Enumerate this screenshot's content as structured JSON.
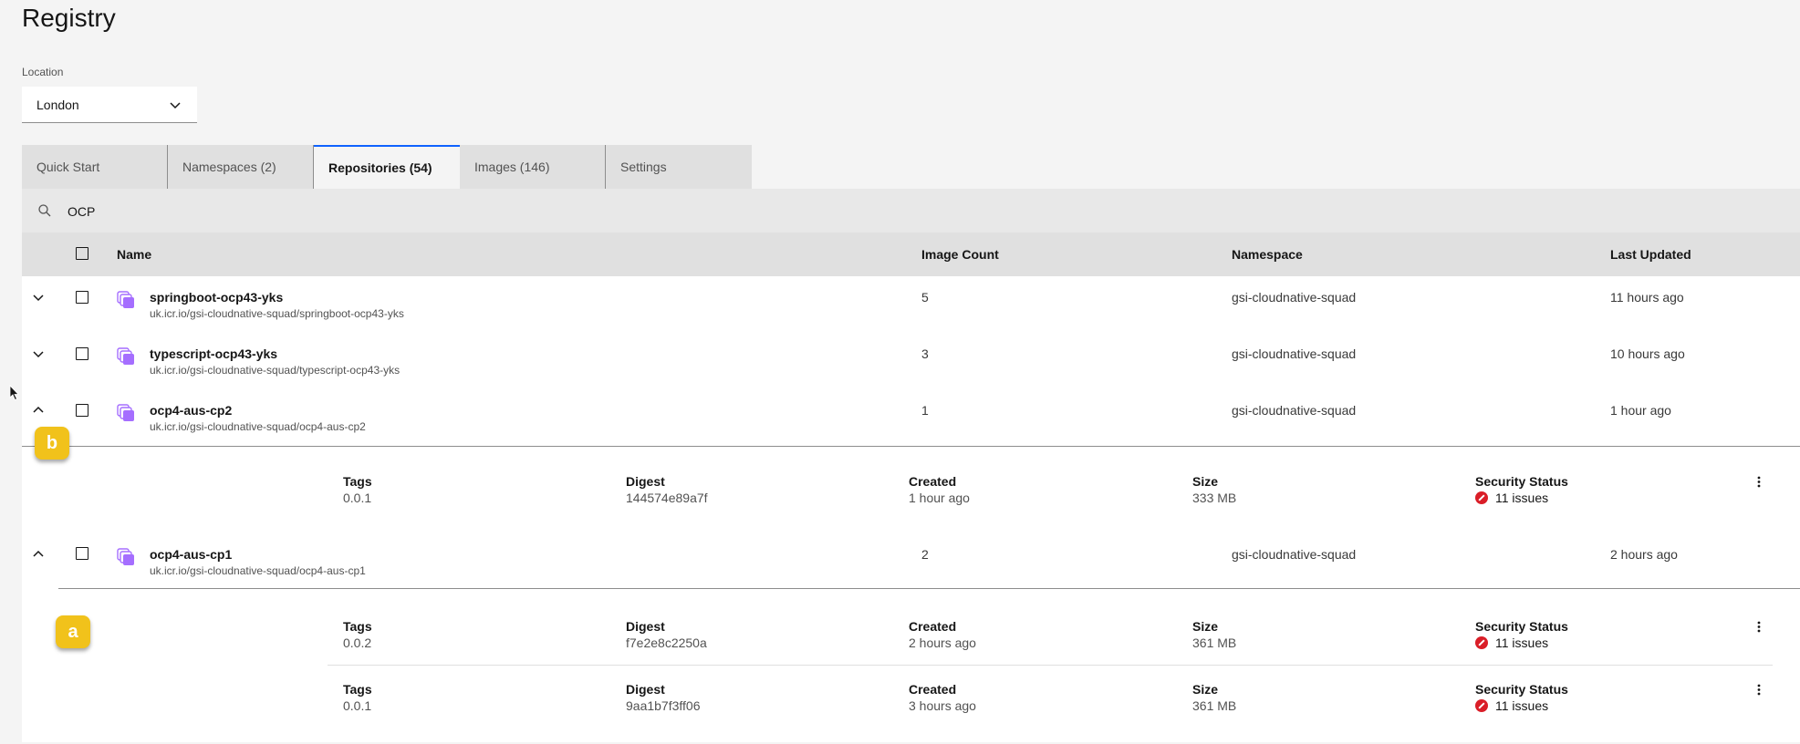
{
  "page": {
    "title": "Registry"
  },
  "location": {
    "label": "Location",
    "value": "London"
  },
  "tabs": [
    {
      "label": "Quick Start",
      "active": false
    },
    {
      "label": "Namespaces (2)",
      "active": false
    },
    {
      "label": "Repositories (54)",
      "active": true
    },
    {
      "label": "Images (146)",
      "active": false
    },
    {
      "label": "Settings",
      "active": false
    }
  ],
  "search": {
    "value": "OCP"
  },
  "table": {
    "headers": {
      "name": "Name",
      "image_count": "Image Count",
      "namespace": "Namespace",
      "last_updated": "Last Updated"
    },
    "rows": [
      {
        "name": "springboot-ocp43-yks",
        "path": "uk.icr.io/gsi-cloudnative-squad/springboot-ocp43-yks",
        "image_count": "5",
        "namespace": "gsi-cloudnative-squad",
        "last_updated": "11 hours ago",
        "expanded": false
      },
      {
        "name": "typescript-ocp43-yks",
        "path": "uk.icr.io/gsi-cloudnative-squad/typescript-ocp43-yks",
        "image_count": "3",
        "namespace": "gsi-cloudnative-squad",
        "last_updated": "10 hours ago",
        "expanded": false
      },
      {
        "name": "ocp4-aus-cp2",
        "path": "uk.icr.io/gsi-cloudnative-squad/ocp4-aus-cp2",
        "image_count": "1",
        "namespace": "gsi-cloudnative-squad",
        "last_updated": "1 hour ago",
        "expanded": true
      },
      {
        "name": "ocp4-aus-cp1",
        "path": "uk.icr.io/gsi-cloudnative-squad/ocp4-aus-cp1",
        "image_count": "2",
        "namespace": "gsi-cloudnative-squad",
        "last_updated": "2 hours ago",
        "expanded": true
      }
    ]
  },
  "detail_labels": {
    "tags": "Tags",
    "digest": "Digest",
    "created": "Created",
    "size": "Size",
    "security": "Security Status"
  },
  "details": {
    "cp2": [
      {
        "tags": "0.0.1",
        "digest": "144574e89a7f",
        "created": "1 hour ago",
        "size": "333 MB",
        "security": "11 issues"
      }
    ],
    "cp1": [
      {
        "tags": "0.0.2",
        "digest": "f7e2e8c2250a",
        "created": "2 hours ago",
        "size": "361 MB",
        "security": "11 issues"
      },
      {
        "tags": "0.0.1",
        "digest": "9aa1b7f3ff06",
        "created": "3 hours ago",
        "size": "361 MB",
        "security": "11 issues"
      }
    ]
  },
  "annotations": {
    "b": "b",
    "a": "a"
  },
  "colors": {
    "accent": "#0f62fe",
    "badge": "#f1c21b",
    "repo_icon": "#a56eff",
    "error": "#da1e28"
  }
}
